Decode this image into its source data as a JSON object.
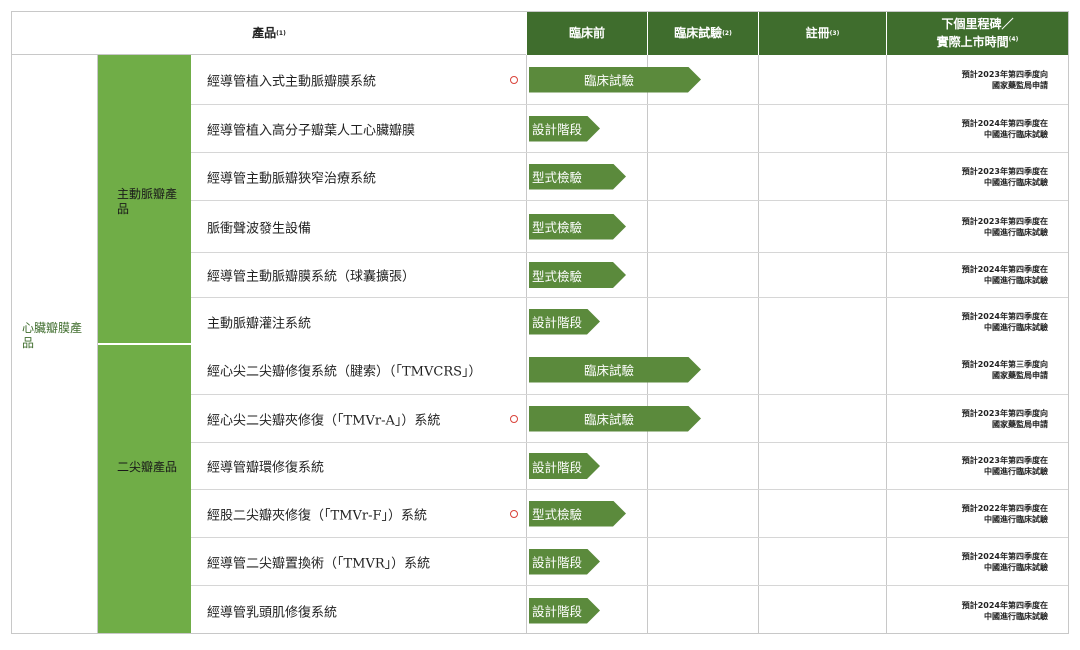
{
  "header": {
    "product": "產品",
    "product_note": "(1)",
    "preclinical": "臨床前",
    "clinical": "臨床試驗",
    "clinical_note": "(2)",
    "registration": "註冊",
    "registration_note": "(3)",
    "milestone_line1": "下個里程碑／",
    "milestone_line2": "實際上市時間",
    "milestone_note": "(4)"
  },
  "category": {
    "heart_valve": "心臟瓣膜產品",
    "aortic": "主動脈瓣產品",
    "mitral": "二尖瓣產品"
  },
  "colors": {
    "header_green": "#3f6d2d",
    "category_green": "#70ad47",
    "arrow_green": "#5b8a3c",
    "marker_red": "#d9433a"
  },
  "rows": [
    {
      "name": "經導管植入式主動脈瓣膜系統",
      "marker": true,
      "stage": "臨床試驗",
      "progress": "clinical",
      "ms1": "預計2023年第四季度向",
      "ms2": "國家藥監局申請"
    },
    {
      "name": "經導管植入高分子瓣葉人工心臟瓣膜",
      "marker": false,
      "stage": "設計階段",
      "progress": "design",
      "ms1": "預計2024年第四季度在",
      "ms2": "中國進行臨床試驗"
    },
    {
      "name": "經導管主動脈瓣狹窄治療系統",
      "marker": false,
      "stage": "型式檢驗",
      "progress": "type",
      "ms1": "預計2023年第四季度在",
      "ms2": "中國進行臨床試驗"
    },
    {
      "name": "脈衝聲波發生設備",
      "marker": false,
      "stage": "型式檢驗",
      "progress": "type",
      "ms1": "預計2023年第四季度在",
      "ms2": "中國進行臨床試驗"
    },
    {
      "name": "經導管主動脈瓣膜系統（球囊擴張）",
      "marker": false,
      "stage": "型式檢驗",
      "progress": "type",
      "ms1": "預計2024年第四季度在",
      "ms2": "中國進行臨床試驗"
    },
    {
      "name": "主動脈瓣灌注系統",
      "marker": false,
      "stage": "設計階段",
      "progress": "design",
      "ms1": "預計2024年第四季度在",
      "ms2": "中國進行臨床試驗"
    },
    {
      "name": "經心尖二尖瓣修復系統（腱索）（「TMVCRS」）",
      "marker": false,
      "stage": "臨床試驗",
      "progress": "clinical",
      "ms1": "預計2024年第三季度向",
      "ms2": "國家藥監局申請"
    },
    {
      "name": "經心尖二尖瓣夾修復（「TMVr-A」）系統",
      "marker": true,
      "stage": "臨床試驗",
      "progress": "clinical",
      "ms1": "預計2023年第四季度向",
      "ms2": "國家藥監局申請"
    },
    {
      "name": "經導管瓣環修復系統",
      "marker": false,
      "stage": "設計階段",
      "progress": "design",
      "ms1": "預計2023年第四季度在",
      "ms2": "中國進行臨床試驗"
    },
    {
      "name": "經股二尖瓣夾修復（「TMVr-F」）系統",
      "marker": true,
      "stage": "型式檢驗",
      "progress": "type",
      "ms1": "預計2022年第四季度在",
      "ms2": "中國進行臨床試驗"
    },
    {
      "name": "經導管二尖瓣置換術（「TMVR」）系統",
      "marker": false,
      "stage": "設計階段",
      "progress": "design",
      "ms1": "預計2024年第四季度在",
      "ms2": "中國進行臨床試驗"
    },
    {
      "name": "經導管乳頭肌修復系統",
      "marker": false,
      "stage": "設計階段",
      "progress": "design",
      "ms1": "預計2024年第四季度在",
      "ms2": "中國進行臨床試驗"
    }
  ]
}
